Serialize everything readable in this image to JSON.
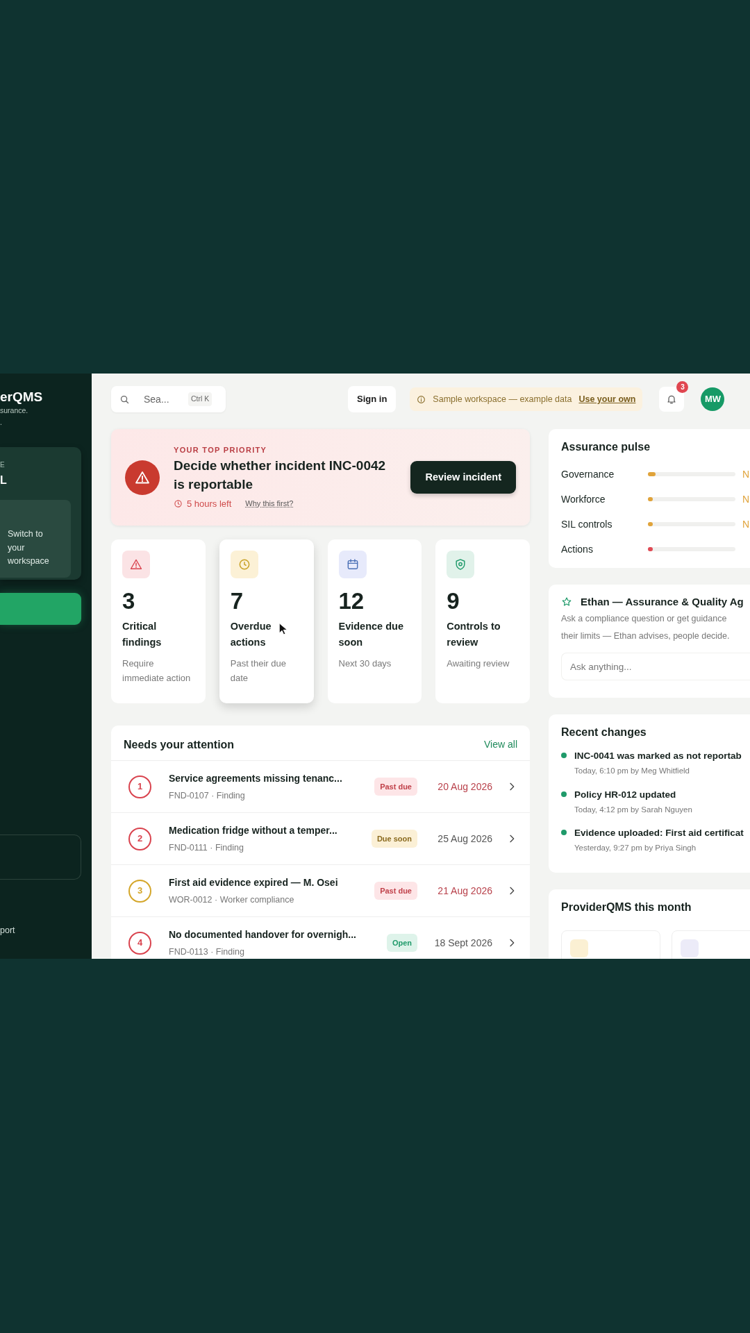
{
  "sidebar": {
    "brand": "erQMS",
    "tagline_lines": [
      "surance.",
      "."
    ],
    "workspace_card": {
      "label": "E",
      "name": "L",
      "switch_text": "Switch to your workspace"
    },
    "footer_link": "port"
  },
  "topbar": {
    "search": {
      "placeholder": "Sea...",
      "shortcut": "Ctrl K"
    },
    "sign_in": "Sign in",
    "banner": {
      "text": "Sample workspace — example data",
      "link": "Use your own"
    },
    "notifications": "3",
    "avatar": "MW"
  },
  "priority": {
    "eyebrow": "YOUR TOP PRIORITY",
    "title": "Decide whether incident INC-0042 is reportable",
    "time_left": "5 hours left",
    "why_link": "Why this first?",
    "button": "Review incident"
  },
  "stats": [
    {
      "kind": "critical",
      "value": "3",
      "label": "Critical findings",
      "note": "Require immediate action",
      "hovered": false
    },
    {
      "kind": "overdue",
      "value": "7",
      "label": "Overdue actions",
      "note": "Past their due date",
      "hovered": true
    },
    {
      "kind": "evidence",
      "value": "12",
      "label": "Evidence due soon",
      "note": "Next 30 days",
      "hovered": false
    },
    {
      "kind": "controls",
      "value": "9",
      "label": "Controls to review",
      "note": "Awaiting review",
      "hovered": false
    }
  ],
  "attention": {
    "title": "Needs your attention",
    "view_all": "View all",
    "rows": [
      {
        "number": "1",
        "color": "#d9434e",
        "title": "Service agreements missing tenanc...",
        "meta": "FND-0107 · Finding",
        "kind": "past_due",
        "status": "Past due",
        "date": "20 Aug 2026"
      },
      {
        "number": "2",
        "color": "#d9434e",
        "title": "Medication fridge without a temper...",
        "meta": "FND-0111 · Finding",
        "kind": "due_soon",
        "status": "Due soon",
        "date": "25 Aug 2026"
      },
      {
        "number": "3",
        "color": "#d4a62a",
        "title": "First aid evidence expired — M. Osei",
        "meta": "WOR-0012 · Worker compliance",
        "kind": "past_due",
        "status": "Past due",
        "date": "21 Aug 2026"
      },
      {
        "number": "4",
        "color": "#d9434e",
        "title": "No documented handover for overnigh...",
        "meta": "FND-0113 · Finding",
        "kind": "open",
        "status": "Open",
        "date": "18 Sept 2026"
      }
    ]
  },
  "pulse": {
    "title": "Assurance pulse",
    "rows": [
      {
        "label": "Governance",
        "level": 0.09,
        "color": "#e0a33a",
        "value": "N"
      },
      {
        "label": "Workforce",
        "level": 0.05,
        "color": "#e0a33a",
        "value": "N"
      },
      {
        "label": "SIL controls",
        "level": 0.04,
        "color": "#e0a33a",
        "value": "N"
      },
      {
        "label": "Actions",
        "level": 0.02,
        "color": "#e04a55"
      }
    ]
  },
  "assistant": {
    "title": "Ethan — Assurance & Quality Ag",
    "lines": [
      "Ask a compliance question or get guidance",
      "their limits — Ethan advises, people decide."
    ],
    "placeholder": "Ask anything..."
  },
  "recent": {
    "title": "Recent changes",
    "items": [
      {
        "title": "INC-0041 was marked as not reportab",
        "meta": "Today, 6:10 pm by Meg Whitfield"
      },
      {
        "title": "Policy HR-012 updated",
        "meta": "Today, 4:12 pm by Sarah Nguyen"
      },
      {
        "title": "Evidence uploaded: First aid certificat",
        "meta": "Yesterday, 9:27 pm by Priya Singh"
      }
    ]
  },
  "month": {
    "title": "ProviderQMS this month",
    "tiles": [
      {
        "kind": "amber"
      },
      {
        "kind": "lavender"
      }
    ]
  }
}
